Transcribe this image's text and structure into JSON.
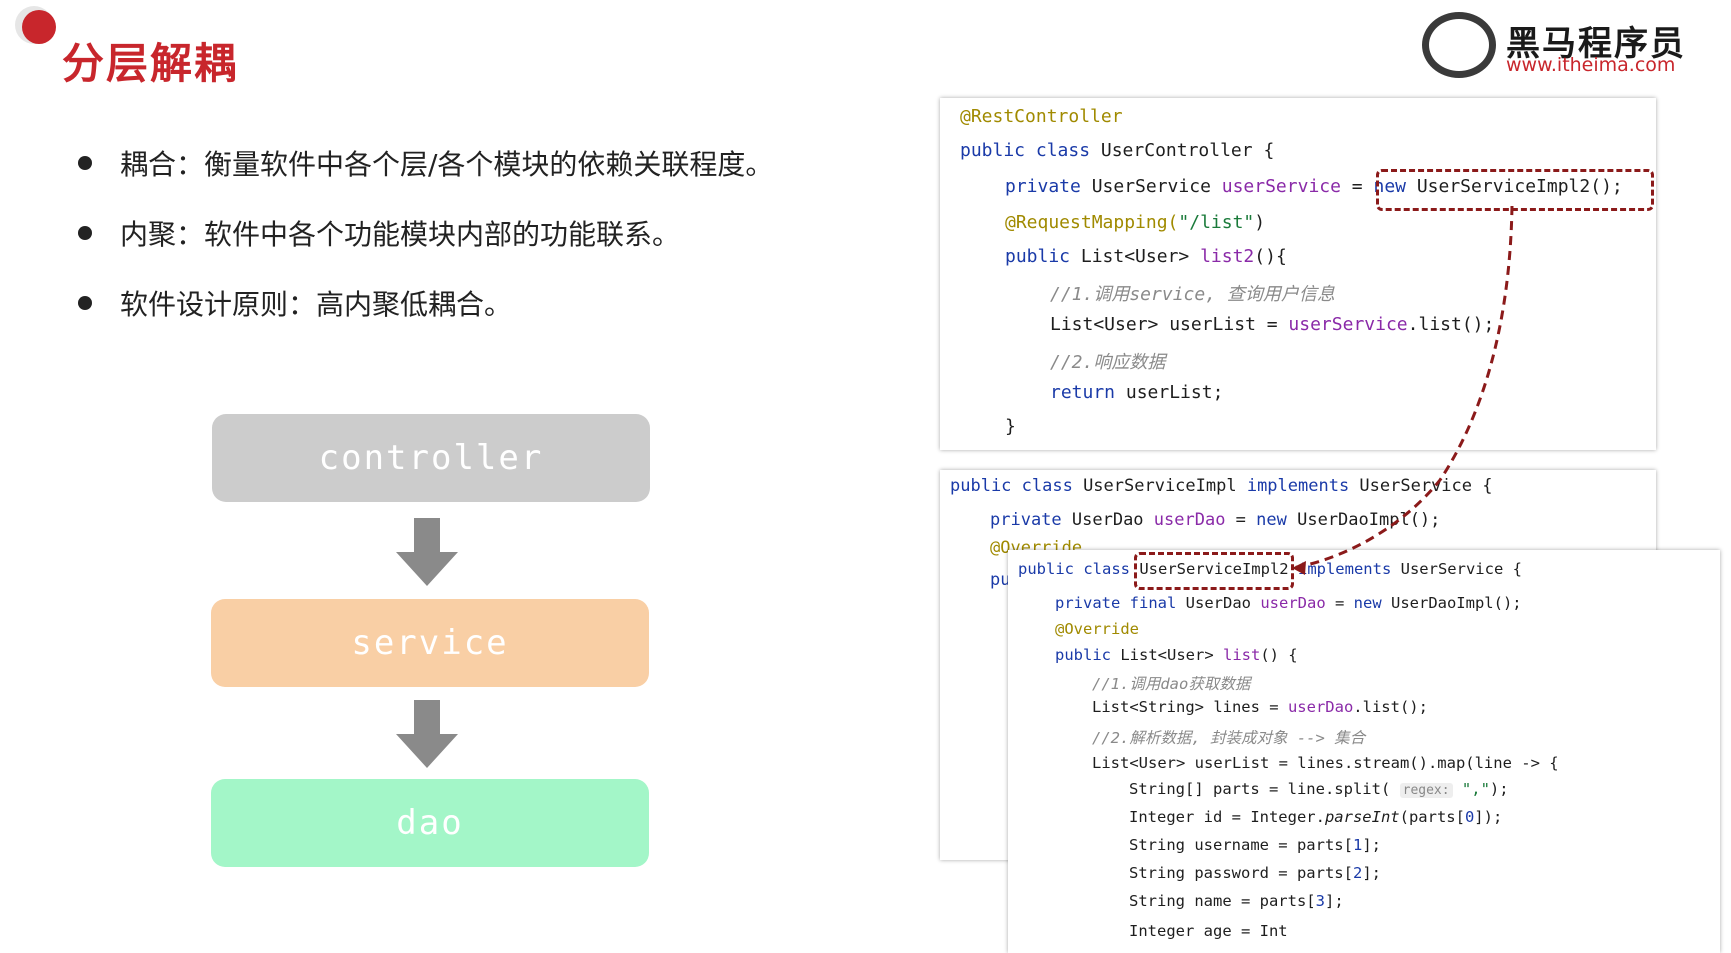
{
  "slide": {
    "title": "分层解耦",
    "logo_cn": "黑马程序员",
    "logo_url": "www.itheima.com",
    "bullets": [
      "耦合：衡量软件中各个层/各个模块的依赖关联程度。",
      "内聚：软件中各个功能模块内部的功能联系。",
      "软件设计原则：高内聚低耦合。"
    ],
    "layers": [
      "controller",
      "service",
      "dao"
    ]
  },
  "code1": {
    "l1": "@RestController",
    "l2_a": "public class",
    "l2_b": " UserController {",
    "l3_a": "private",
    "l3_b": " UserService ",
    "l3_c": "userService",
    "l3_d": " = ",
    "l3_e": "new",
    "l3_f": " UserServiceImpl2();",
    "l4_a": "@RequestMapping(",
    "l4_b": "\"/list\"",
    "l4_c": ")",
    "l5_a": "public",
    "l5_b": " List<User> ",
    "l5_c": "list2",
    "l5_d": "(){",
    "l6": "//1.调用service, 查询用户信息",
    "l7_a": "List<User> userList = ",
    "l7_b": "userService",
    "l7_c": ".list();",
    "l8": "//2.响应数据",
    "l9_a": "return",
    "l9_b": " userList;",
    "l10": "}"
  },
  "code2": {
    "l1_a": "public class",
    "l1_b": " UserServiceImpl ",
    "l1_c": "implements",
    "l1_d": " UserService {",
    "l2_a": "private",
    "l2_b": " UserDao ",
    "l2_c": "userDao",
    "l2_d": " = ",
    "l2_e": "new",
    "l2_f": " UserDaoImpl();",
    "l3": "@Override",
    "l4": "pu"
  },
  "code3": {
    "l1_a": "public class",
    "l1_b": "UserServiceImpl2",
    "l1_c": "implements",
    "l1_d": " UserService {",
    "l2_a": "private final",
    "l2_b": " UserDao ",
    "l2_c": "userDao",
    "l2_d": " = ",
    "l2_e": "new",
    "l2_f": " UserDaoImpl();",
    "l3": "@Override",
    "l4_a": "public",
    "l4_b": " List<User> ",
    "l4_c": "list",
    "l4_d": "() {",
    "l5": "//1.调用dao获取数据",
    "l6_a": "List<String> lines = ",
    "l6_b": "userDao",
    "l6_c": ".list();",
    "l7": "//2.解析数据, 封装成对象 --> 集合",
    "l8": "List<User> userList = lines.stream().map(line -> {",
    "l9_a": "String[] parts = line.split( ",
    "l9_hint": "regex:",
    "l9_b": " \",\"",
    "l9_c": ");",
    "l10_a": "Integer id = Integer.",
    "l10_b": "parseInt",
    "l10_c": "(parts[",
    "l10_d": "0",
    "l10_e": "]);",
    "l11_a": "String username = parts[",
    "l11_b": "1",
    "l11_c": "];",
    "l12_a": "String password = parts[",
    "l12_b": "2",
    "l12_c": "];",
    "l13_a": "String name = parts[",
    "l13_b": "3",
    "l13_c": "];",
    "l14": "Integer age = Int"
  },
  "colors": {
    "accent_red": "#c8262c",
    "controller": "#cccccc",
    "service": "#f9cfa5",
    "dao": "#a3f6c8",
    "arrow": "#8a8a8a",
    "dashed_link": "#8b1a1a"
  }
}
